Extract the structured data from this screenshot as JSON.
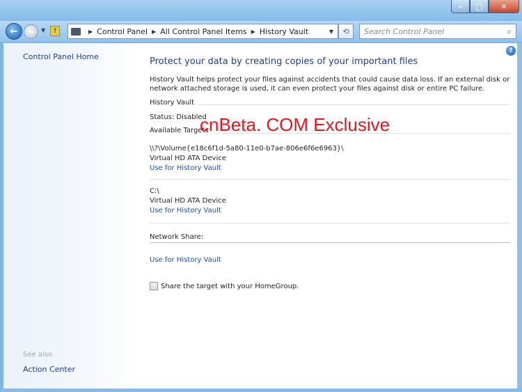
{
  "window": {
    "minimize_glyph": "–",
    "maximize_glyph": "□",
    "close_glyph": "✕"
  },
  "nav": {
    "back_glyph": "←",
    "forward_glyph": "→",
    "breadcrumbs": [
      "Control Panel",
      "All Control Panel Items",
      "History Vault"
    ],
    "search_placeholder": "Search Control Panel"
  },
  "left": {
    "home_link": "Control Panel Home",
    "see_also": "See also",
    "action_center": "Action Center"
  },
  "main": {
    "title": "Protect your data by creating copies of your important files",
    "intro": "History Vault helps protect your files against accidents that could cause data loss. If an external disk or network attached storage is used, it can even protect your files against disk or entire PC failure.",
    "section_label": "History Vault",
    "status": "Status: Disabled",
    "available_targets": "Available Targets",
    "targets": [
      {
        "path": "\\\\?\\Volume{e18c6f1d-5a80-11e0-b7ae-806e6f6e6963}\\",
        "device": "Virtual HD ATA Device",
        "link": "Use for History Vault"
      },
      {
        "path": "C:\\",
        "device": "Virtual HD ATA Device",
        "link": "Use for History Vault"
      }
    ],
    "network_share_label": "Network Share:",
    "network_link": "Use for History Vault",
    "share_checkbox_label": "Share the target with your HomeGroup.",
    "share_checked": false
  },
  "watermark": "cnBeta. COM Exclusive"
}
